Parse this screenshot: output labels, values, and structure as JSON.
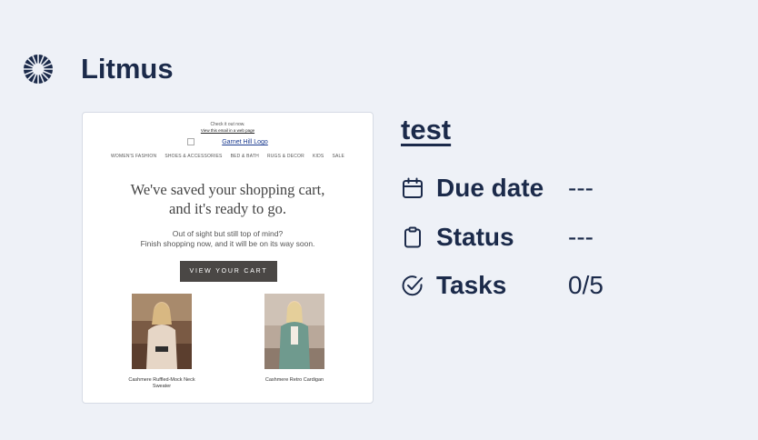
{
  "app": {
    "title": "Litmus",
    "logo_icon": "litmus-logo-icon"
  },
  "preview": {
    "top_note": "Check it out now.",
    "top_link": "View this email in a web page",
    "logo_alt": "Garnet Hill Logo",
    "nav": [
      "WOMEN'S FASHION",
      "SHOES & ACCESSORIES",
      "BED & BATH",
      "RUGS & DECOR",
      "KIDS",
      "SALE"
    ],
    "headline_line1": "We've saved your shopping cart,",
    "headline_line2": "and it's ready to go.",
    "sub_line1": "Out of sight but still top of mind?",
    "sub_line2": "Finish shopping now, and it will be on its way soon.",
    "cta": "VIEW YOUR CART",
    "products": [
      {
        "name": "Cashmere Ruffled-Mock Neck Sweater"
      },
      {
        "name": "Cashmere Retro Cardigan"
      }
    ]
  },
  "task": {
    "title": "test",
    "rows": [
      {
        "icon": "calendar-icon",
        "label": "Due date",
        "value": "---"
      },
      {
        "icon": "clipboard-icon",
        "label": "Status",
        "value": "---"
      },
      {
        "icon": "check-circle-icon",
        "label": "Tasks",
        "value": "0/5"
      }
    ]
  },
  "colors": {
    "background": "#eef1f7",
    "text": "#1b2a4a",
    "button": "#4a4745"
  }
}
